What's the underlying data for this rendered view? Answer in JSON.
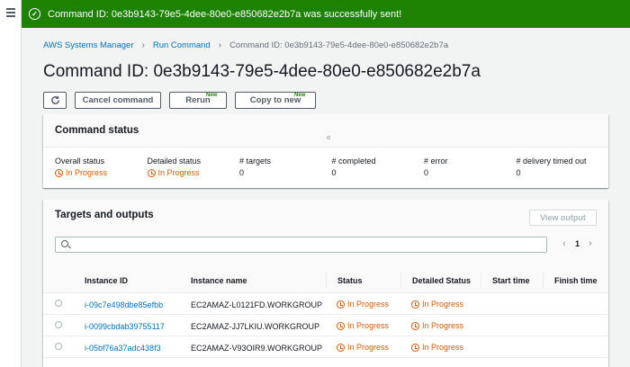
{
  "flash": {
    "message": "Command ID: 0e3b9143-79e5-4dee-80e0-e850682e2b7a was successfully sent!",
    "color": "#1d8102"
  },
  "breadcrumb": {
    "items": [
      "AWS Systems Manager",
      "Run Command"
    ],
    "current": "Command ID: 0e3b9143-79e5-4dee-80e0-e850682e2b7a"
  },
  "title": "Command ID: 0e3b9143-79e5-4dee-80e0-e850682e2b7a",
  "toolbar": {
    "refresh_icon": "refresh-icon",
    "cancel": "Cancel command",
    "rerun": "Rerun",
    "copy": "Copy to new",
    "new_badge": "New"
  },
  "status_panel": {
    "heading": "Command status",
    "overall_label": "Overall status",
    "overall_value": "In Progress",
    "detailed_label": "Detailed status",
    "detailed_value": "In Progress",
    "targets_label": "# targets",
    "targets_value": "0",
    "completed_label": "# completed",
    "completed_value": "0",
    "error_label": "# error",
    "error_value": "0",
    "timedout_label": "# delivery timed out",
    "timedout_value": "0"
  },
  "targets_panel": {
    "heading": "Targets and outputs",
    "view_output": "View output",
    "search_placeholder": "",
    "page": "1",
    "prev": "‹",
    "next": "›",
    "columns": [
      "Instance ID",
      "Instance name",
      "Status",
      "Detailed Status",
      "Start time",
      "Finish time"
    ],
    "rows": [
      {
        "id": "i-09c7e498dbe85efbb",
        "name": "EC2AMAZ-L0121FD.WORKGROUP",
        "status": "In Progress",
        "detailed": "In Progress"
      },
      {
        "id": "i-0099cbdab39755117",
        "name": "EC2AMAZ-JJ7LKIU.WORKGROUP",
        "status": "In Progress",
        "detailed": "In Progress"
      },
      {
        "id": "i-05bf76a37adc438f3",
        "name": "EC2AMAZ-V93OIR9.WORKGROUP",
        "status": "In Progress",
        "detailed": "In Progress"
      }
    ]
  },
  "colors": {
    "link": "#0073bb",
    "in_progress": "#d45b07"
  }
}
